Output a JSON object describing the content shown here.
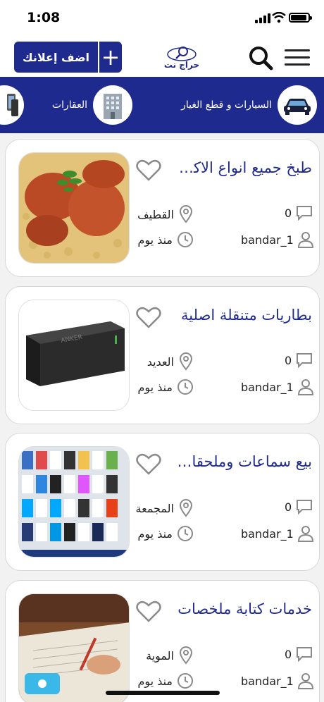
{
  "status_bar": {
    "time": "1:08"
  },
  "header": {
    "add_ad_label": "اضف إعلانك",
    "logo_text": "حراج نت"
  },
  "categories": [
    {
      "label": "السيارات و قطع الغيار"
    },
    {
      "label": "العقارات"
    }
  ],
  "listings": [
    {
      "title": "طبخ جميع انواع الاكلات",
      "location": "القطيف",
      "time_ago": "منذ يوم",
      "comments": "0",
      "user": "bandar_1"
    },
    {
      "title": "بطاريات متنقلة اصلية",
      "location": "العديد",
      "time_ago": "منذ يوم",
      "comments": "0",
      "user": "bandar_1"
    },
    {
      "title": "بيع سماعات وملحقات الجوال",
      "location": "المجمعة",
      "time_ago": "منذ يوم",
      "comments": "0",
      "user": "bandar_1"
    },
    {
      "title": "خدمات كتابة ملخصات",
      "location": "الموية",
      "time_ago": "منذ يوم",
      "comments": "0",
      "user": "bandar_1"
    }
  ],
  "colors": {
    "brand": "#1f2a8e",
    "background": "#f2f2f2"
  }
}
